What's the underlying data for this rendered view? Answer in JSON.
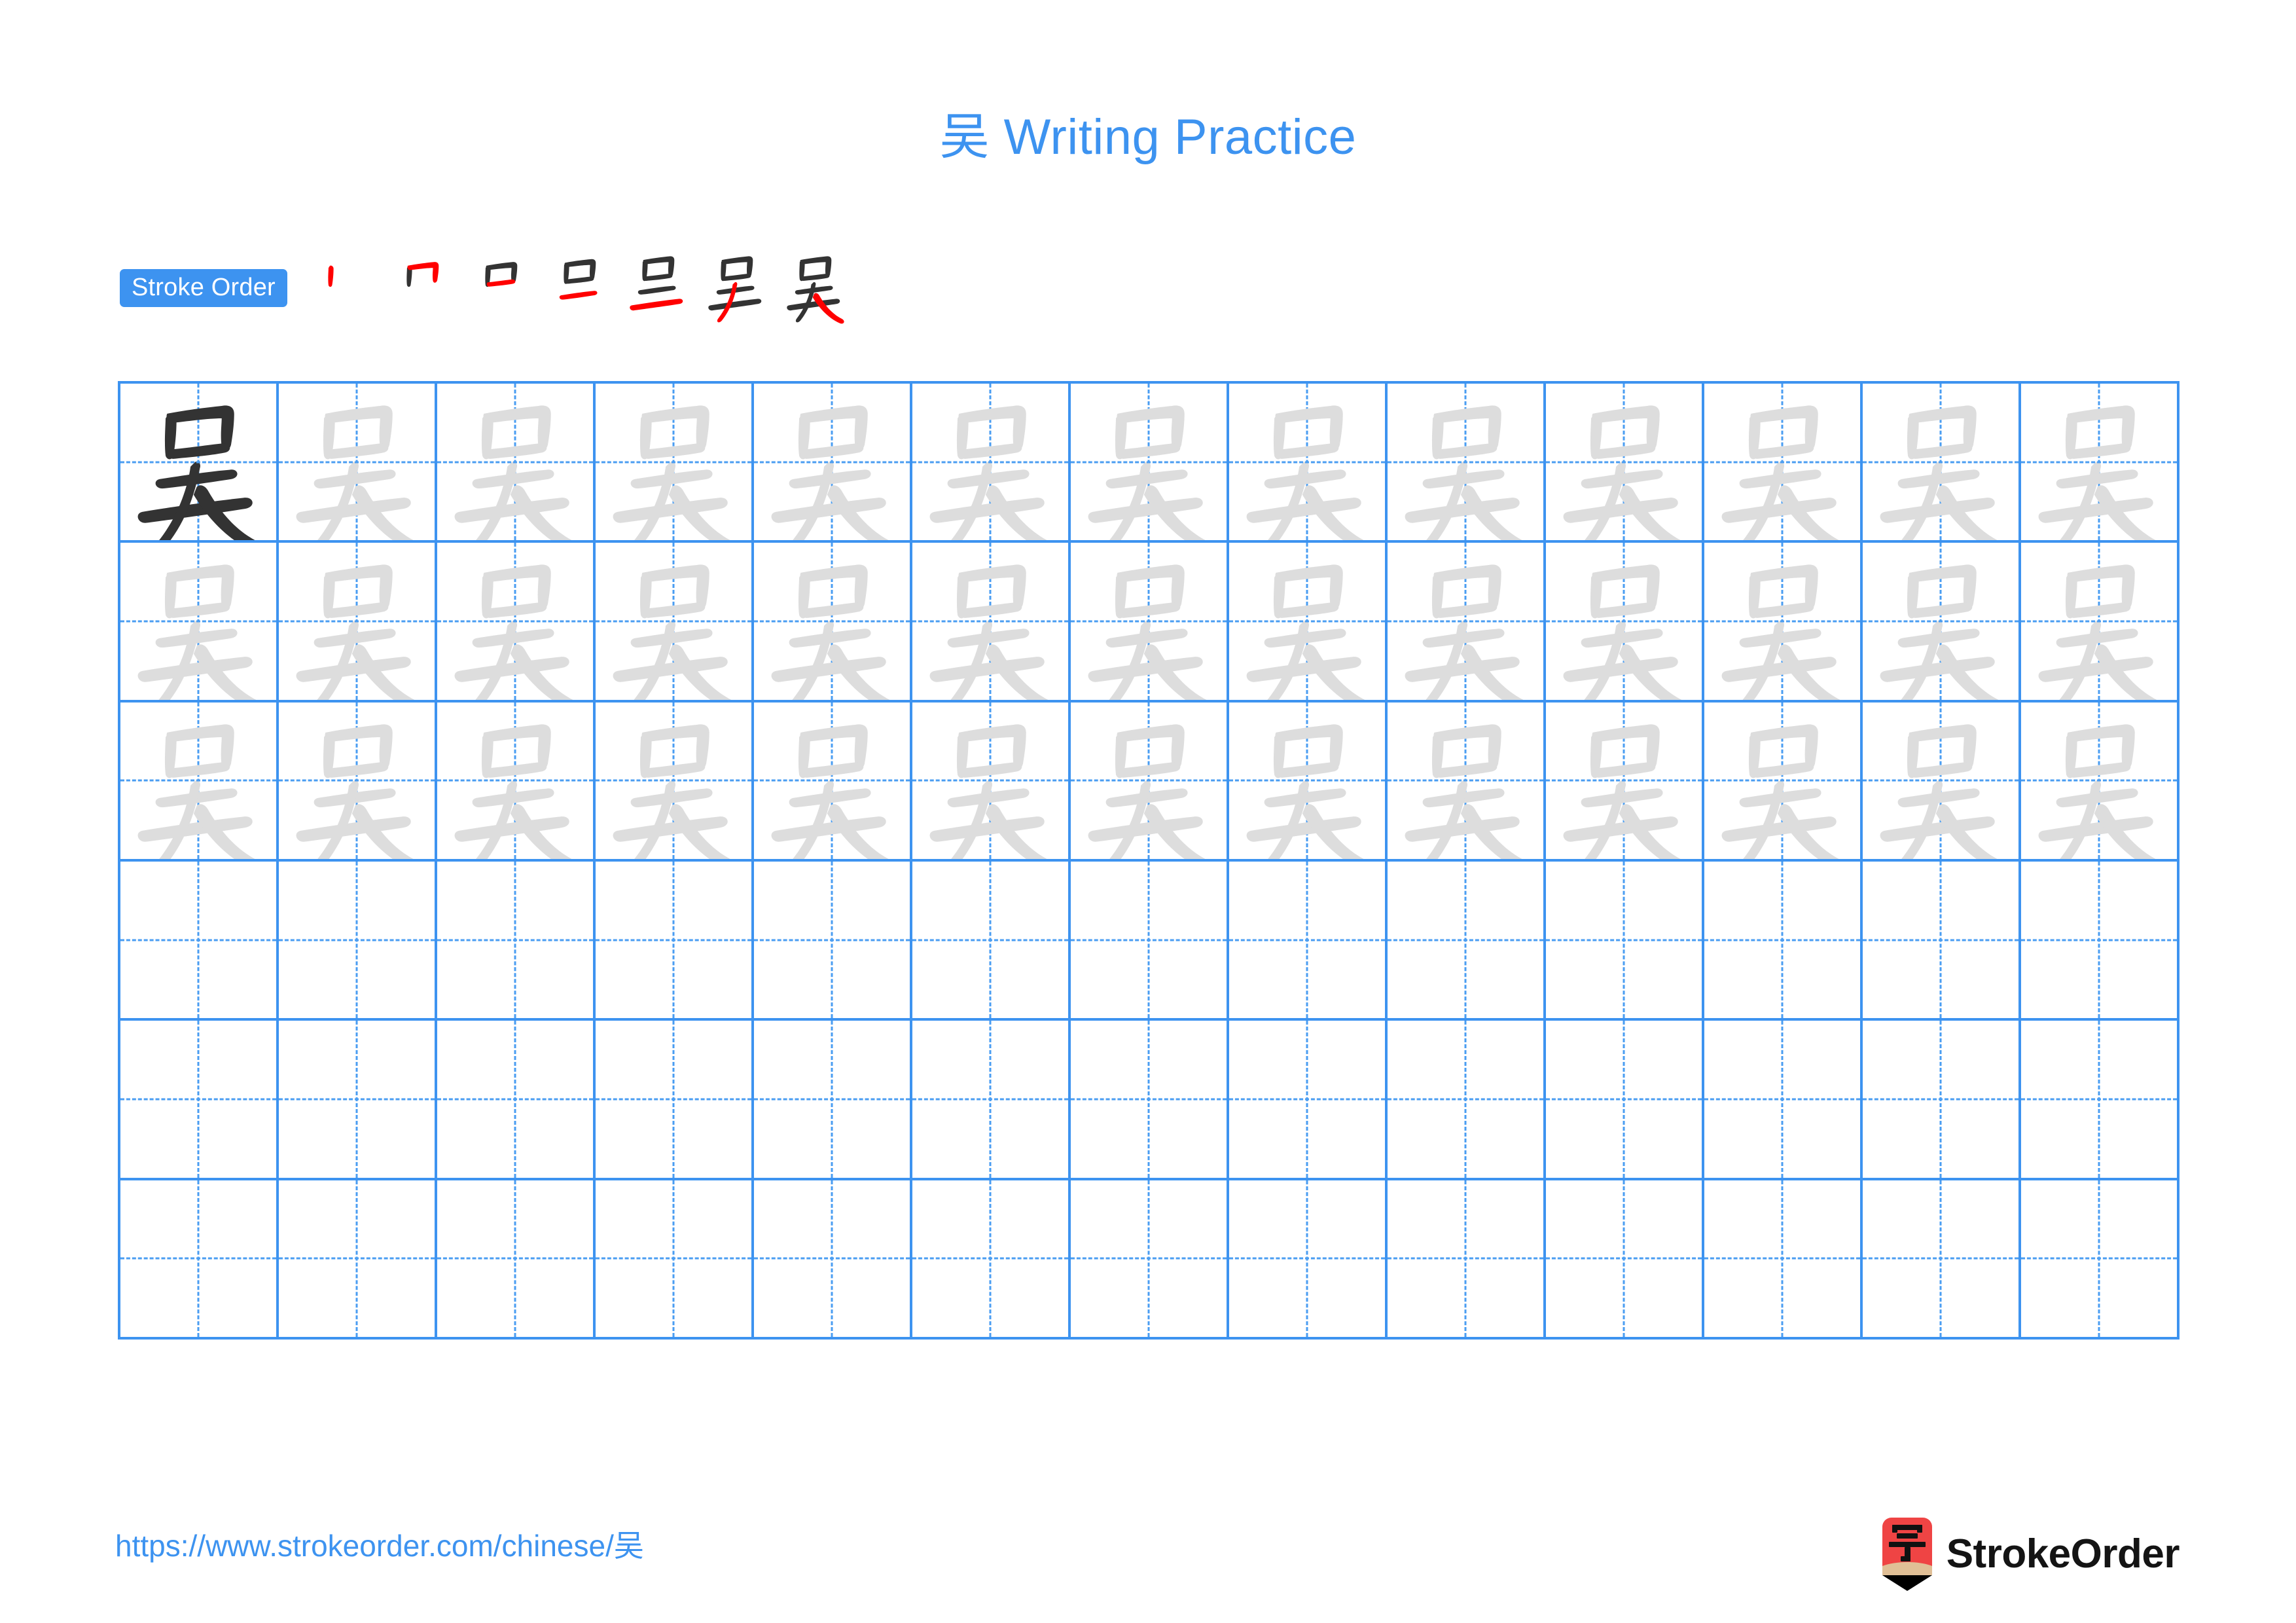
{
  "page": {
    "character": "吴",
    "title": "吴 Writing Practice",
    "accent_color": "#3d93f0",
    "grid_line_color": "#3d93f0",
    "dashed_line_color": "#4a9df2",
    "traced_char_color": "#dddddd",
    "solid_char_color": "#333333",
    "new_stroke_color": "#ff0000",
    "prior_stroke_color": "#333333"
  },
  "stroke_order": {
    "badge_label": "Stroke Order",
    "total_strokes": 7,
    "steps": [
      {
        "index": 1,
        "strokes_shown": 1
      },
      {
        "index": 2,
        "strokes_shown": 2
      },
      {
        "index": 3,
        "strokes_shown": 3
      },
      {
        "index": 4,
        "strokes_shown": 4
      },
      {
        "index": 5,
        "strokes_shown": 5
      },
      {
        "index": 6,
        "strokes_shown": 6
      },
      {
        "index": 7,
        "strokes_shown": 7
      }
    ]
  },
  "practice_grid": {
    "columns": 13,
    "rows": 6,
    "filled_rows": 3,
    "empty_rows": 3,
    "first_cell_style": "solid",
    "traced_cells_count": 38
  },
  "footer": {
    "url": "https://www.strokeorder.com/chinese/吴",
    "brand_name": "StrokeOrder",
    "logo_glyph": "字",
    "logo_body_color": "#ef4444",
    "logo_wood_color": "#e0bf96",
    "logo_tip_color": "#000000"
  }
}
